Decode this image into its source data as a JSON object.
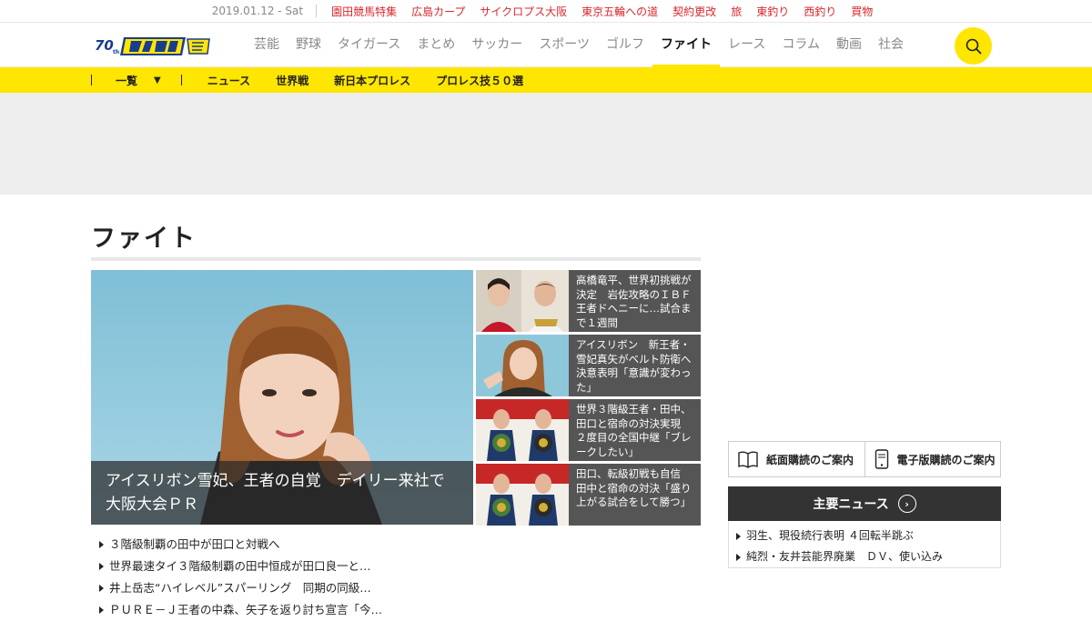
{
  "topbar": {
    "date": "2019.01.12 - Sat",
    "links": [
      "園田競馬特集",
      "広島カープ",
      "サイクロプス大阪",
      "東京五輪への道",
      "契約更改",
      "旅",
      "東釣り",
      "西釣り",
      "買物"
    ]
  },
  "header": {
    "logo_icon": "daily-sports-70th-logo",
    "nav": [
      "芸能",
      "野球",
      "タイガース",
      "まとめ",
      "サッカー",
      "スポーツ",
      "ゴルフ",
      "ファイト",
      "レース",
      "コラム",
      "動画",
      "社会"
    ],
    "active_index": 7,
    "search_icon": "search-icon",
    "accent_color": "#ffe600"
  },
  "subnav": {
    "dropdown_label": "一覧",
    "links": [
      "ニュース",
      "世界戦",
      "新日本プロレス",
      "プロレス技５０選"
    ]
  },
  "main": {
    "page_title": "ファイト",
    "hero": {
      "caption": "アイスリボン雪妃、王者の自覚　デイリー来社で大阪大会ＰＲ"
    },
    "side_items": [
      {
        "text": "高橋竜平、世界初挑戦が決定　岩佐攻略のＩＢＦ王者ドヘニーに…試合まで１週間"
      },
      {
        "text": "アイスリボン　新王者・雪妃真矢がベルト防衛へ決意表明「意識が変わった」"
      },
      {
        "text": "世界３階級王者・田中、田口と宿命の対決実現　２度目の全国中継「ブレークしたい」"
      },
      {
        "text": "田口、転級初戦も自信　田中と宿命の対決「盛り上がる試合をして勝つ」"
      }
    ],
    "news": [
      "３階級制覇の田中が田口と対戦へ",
      "世界最速タイ３階級制覇の田中恒成が田口良一と…",
      "井上岳志“ハイレベル”スパーリング　同期の同級…",
      "ＰＵＲＥ－Ｊ王者の中森、矢子を返り討ち宣言「今…"
    ]
  },
  "sidebar": {
    "paper_label": "紙面購読のご案内",
    "digital_label": "電子版購読のご案内",
    "major_news_title": "主要ニュース",
    "major_news": [
      "羽生、現役続行表明 ４回転半跳ぶ",
      "純烈・友井芸能界廃業　ＤＶ、使い込み"
    ]
  }
}
